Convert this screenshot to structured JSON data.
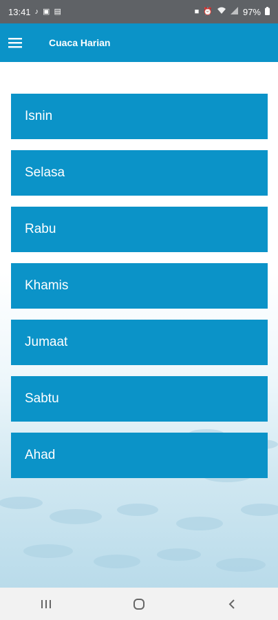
{
  "status_bar": {
    "time": "13:41",
    "battery": "97%",
    "left_icons": [
      "tiktok-icon",
      "app-icon",
      "image-icon"
    ],
    "right_icons": [
      "lock-icon",
      "alarm-icon",
      "wifi-icon",
      "signal-icon",
      "battery-icon"
    ]
  },
  "app_bar": {
    "title": "Cuaca Harian",
    "menu_icon": "hamburger-menu-icon"
  },
  "days": [
    {
      "label": "Isnin"
    },
    {
      "label": "Selasa"
    },
    {
      "label": "Rabu"
    },
    {
      "label": "Khamis"
    },
    {
      "label": "Jumaat"
    },
    {
      "label": "Sabtu"
    },
    {
      "label": "Ahad"
    }
  ],
  "nav_bar": {
    "buttons": [
      "recent-apps-icon",
      "home-icon",
      "back-icon"
    ]
  },
  "colors": {
    "primary": "#0b93c8",
    "status_bar": "#5f6266",
    "nav_bar": "#f2f2f2"
  }
}
